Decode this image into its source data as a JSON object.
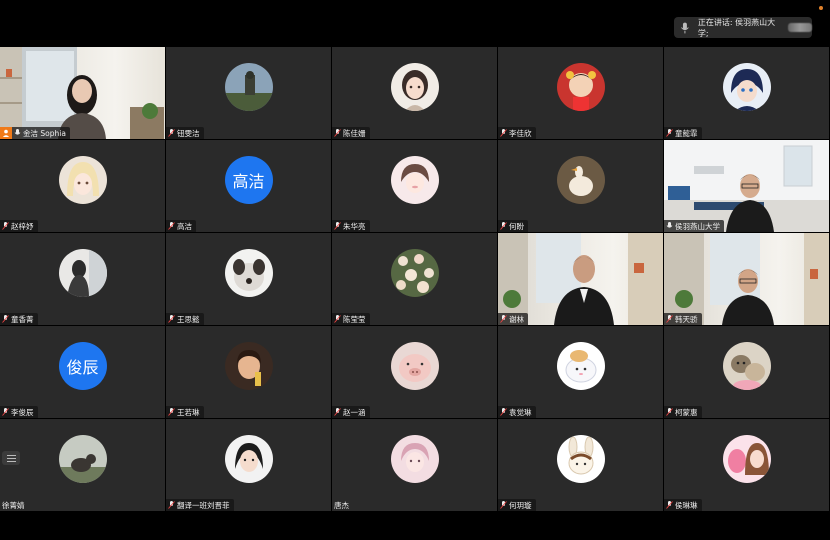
{
  "speaking_indicator": {
    "label": "正在讲话: 侯羽燕山大学;"
  },
  "colors": {
    "avatar_blue": "#1e76f0",
    "active_border": "#3aa657",
    "host_badge": "#f07a18"
  },
  "participants": [
    {
      "name": "金洁 Sophia",
      "type": "video",
      "host": true
    },
    {
      "name": "钮雯洁",
      "type": "avatar-image"
    },
    {
      "name": "陈佳姗",
      "type": "avatar-image"
    },
    {
      "name": "李佳欣",
      "type": "avatar-image"
    },
    {
      "name": "童懿霏",
      "type": "avatar-image"
    },
    {
      "name": "赵梓妤",
      "type": "avatar-image"
    },
    {
      "name": "高洁",
      "type": "avatar-text",
      "initials": "高洁"
    },
    {
      "name": "朱华亮",
      "type": "avatar-image"
    },
    {
      "name": "何盼",
      "type": "avatar-image"
    },
    {
      "name": "侯羽燕山大学",
      "type": "video",
      "active": true
    },
    {
      "name": "童香菁",
      "type": "avatar-image"
    },
    {
      "name": "王思懿",
      "type": "avatar-image"
    },
    {
      "name": "陈莹莹",
      "type": "avatar-image"
    },
    {
      "name": "谢林",
      "type": "video"
    },
    {
      "name": "韩天骄",
      "type": "video"
    },
    {
      "name": "李俊辰",
      "type": "avatar-text",
      "initials": "俊辰"
    },
    {
      "name": "王若琳",
      "type": "avatar-image"
    },
    {
      "name": "赵一涵",
      "type": "avatar-image"
    },
    {
      "name": "袁觉琳",
      "type": "avatar-image"
    },
    {
      "name": "柯蒙惠",
      "type": "avatar-image"
    },
    {
      "name": "徐菁婧",
      "type": "avatar-image",
      "no_mic_icon": true
    },
    {
      "name": "翻译一班刘晋菲",
      "type": "avatar-image"
    },
    {
      "name": "唐杰",
      "type": "avatar-image",
      "no_mic_icon": true
    },
    {
      "name": "何玥璇",
      "type": "avatar-image"
    },
    {
      "name": "侯琳琳",
      "type": "avatar-image"
    }
  ]
}
